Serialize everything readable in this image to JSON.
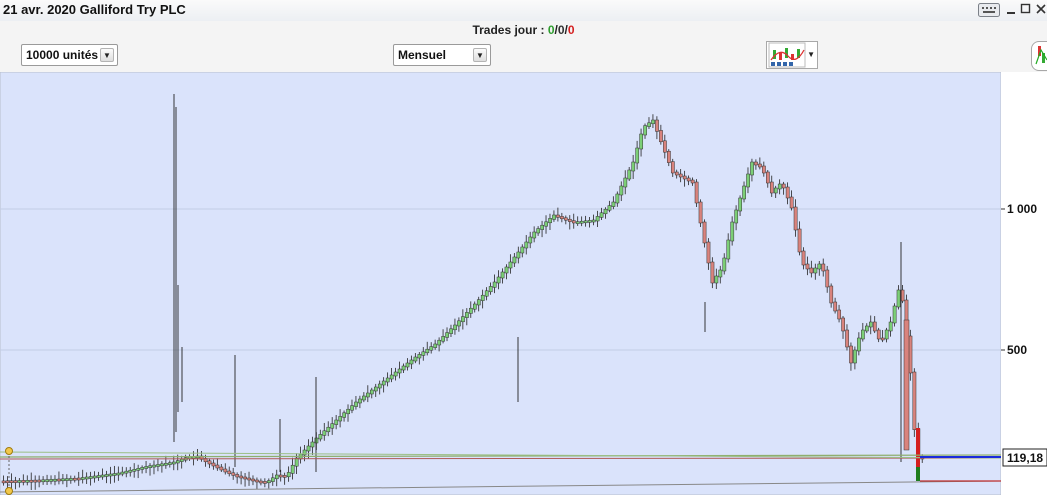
{
  "window": {
    "title": "21 avr. 2020 Galliford Try PLC",
    "controls": [
      "keyboard-icon",
      "minimize-icon",
      "maximize-icon",
      "close-icon"
    ]
  },
  "trades": {
    "label": "Trades jour :",
    "v1": "0",
    "sep1": "/",
    "v2": "0",
    "sep2": "/",
    "v3": "0",
    "colors": {
      "v1": "#2e9d2e",
      "v2": "#333333",
      "v3": "#d42020"
    }
  },
  "toolbar": {
    "quantity": "10000 unités",
    "period": "Mensuel",
    "chart_tool_icon": "chart-style-icon",
    "right_icon": "indicator-icon"
  },
  "chart_data": {
    "type": "candlestick",
    "y_ticks": [
      "1 000",
      "500"
    ],
    "price_label": "119,18",
    "grid": true,
    "colors": {
      "up": "#7ccf77",
      "down": "#d9837d",
      "background": "#dae3fb",
      "price_line": "#1a2bdd"
    },
    "ohlc": []
  }
}
